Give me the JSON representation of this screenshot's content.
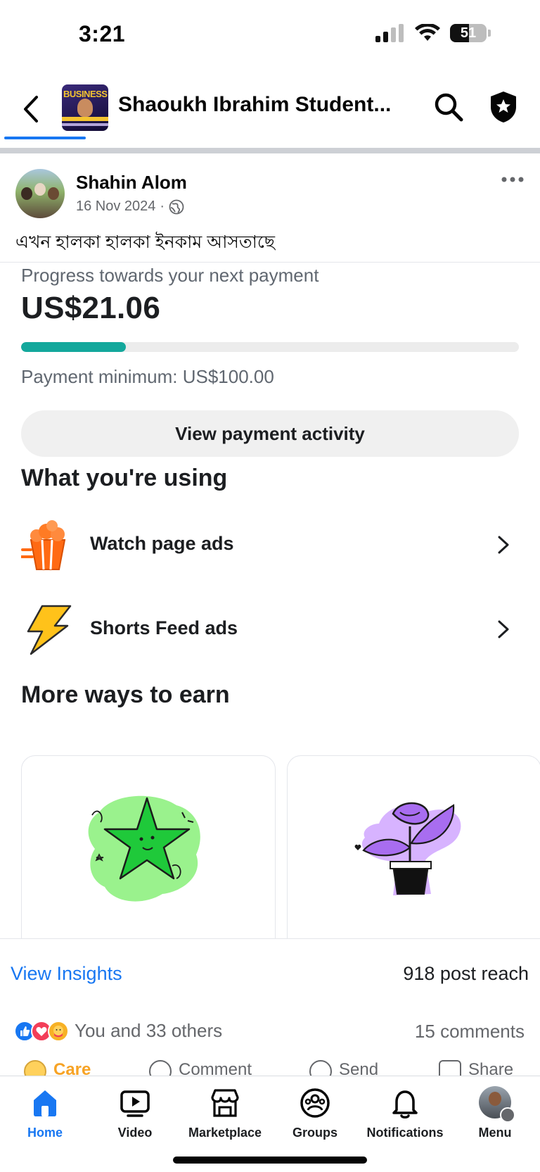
{
  "status_bar": {
    "time": "3:21",
    "battery": "51"
  },
  "header": {
    "group_name": "Shaoukh Ibrahim Student...",
    "group_avatar_text": "BUSINESS"
  },
  "post": {
    "author": "Shahin Alom",
    "date": "16 Nov 2024",
    "separator": "·",
    "text": "এখন হালকা হালকা ইনকাম আসতাছে"
  },
  "screenshot": {
    "progress_label": "Progress towards your next payment",
    "amount": "US$21.06",
    "progress_fraction": 0.21,
    "payment_minimum": "Payment minimum: US$100.00",
    "view_activity_label": "View payment activity",
    "using_title": "What you're using",
    "using_items": [
      {
        "label": "Watch page ads",
        "icon": "popcorn-icon"
      },
      {
        "label": "Shorts Feed ads",
        "icon": "lightning-icon"
      }
    ],
    "earn_title": "More ways to earn",
    "earn_cards": [
      {
        "icon": "star-icon"
      },
      {
        "icon": "plant-icon"
      }
    ]
  },
  "footer": {
    "insights_link": "View Insights",
    "reach": "918 post reach",
    "reactions_text": "You and 33 others",
    "comments": "15 comments",
    "actions": [
      "Care",
      "Comment",
      "Send",
      "Share"
    ]
  },
  "tabs": [
    {
      "label": "Home",
      "icon": "home-icon",
      "active": true
    },
    {
      "label": "Video",
      "icon": "video-icon"
    },
    {
      "label": "Marketplace",
      "icon": "marketplace-icon"
    },
    {
      "label": "Groups",
      "icon": "groups-icon"
    },
    {
      "label": "Notifications",
      "icon": "bell-icon"
    },
    {
      "label": "Menu",
      "icon": "menu-avatar"
    }
  ],
  "colors": {
    "brand_blue": "#1877f2",
    "progress_teal": "#14a89c",
    "meta_gray": "#65676b"
  }
}
